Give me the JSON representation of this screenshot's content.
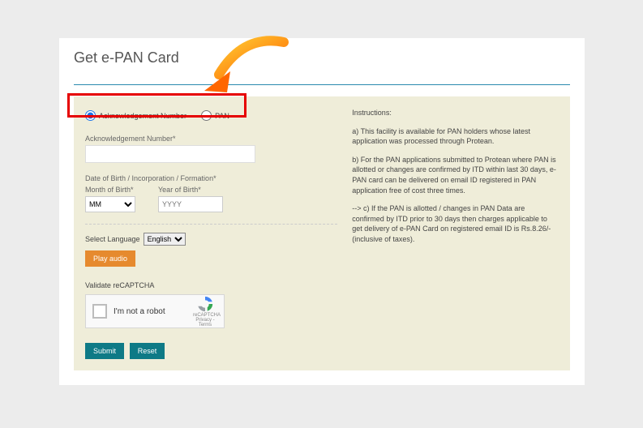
{
  "title": "Get e-PAN Card",
  "radios": {
    "ack": "Acknowledgement Number",
    "pan": "PAN"
  },
  "form": {
    "ack_label": "Acknowledgement Number*",
    "dob_label": "Date of Birth / Incorporation / Formation*",
    "month_label": "Month of Birth*",
    "month_placeholder": "MM",
    "year_label": "Year of Birth*",
    "year_placeholder": "YYYY",
    "select_lang_label": "Select Language",
    "lang_value": "English",
    "play_audio": "Play audio",
    "captcha_label": "Validate reCAPTCHA",
    "captcha_text": "I'm not a robot",
    "captcha_brand": "reCAPTCHA",
    "captcha_sub": "Privacy - Terms",
    "submit": "Submit",
    "reset": "Reset"
  },
  "instructions": {
    "head": "Instructions:",
    "a": "a) This facility is available for PAN holders whose latest application was processed through Protean.",
    "b": "b) For the PAN applications submitted to Protean where PAN is allotted or changes are confirmed by ITD within last 30 days, e-PAN card can be delivered on email ID registered in PAN application free of cost three times.",
    "c": "--> c) If the PAN is allotted / changes in PAN Data are confirmed by ITD prior to 30 days then charges applicable to get delivery of e-PAN Card on registered email ID is Rs.8.26/- (inclusive of taxes)."
  }
}
